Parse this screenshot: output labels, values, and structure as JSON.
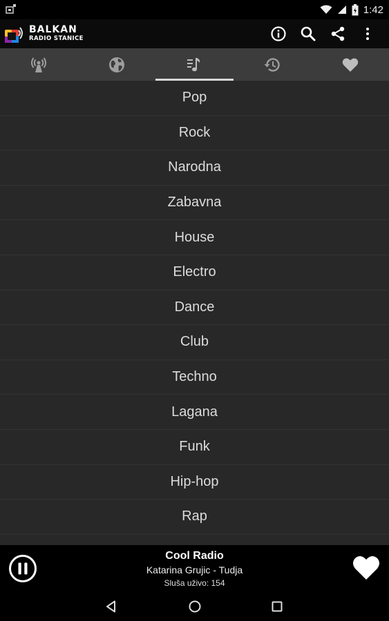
{
  "status_bar": {
    "time": "1:42",
    "icons": [
      "notification-icon",
      "wifi-icon",
      "cell-signal-icon",
      "battery-icon"
    ]
  },
  "app_bar": {
    "logo": {
      "line1": "BALKAN",
      "line2": "RADIO STANICE"
    },
    "actions": [
      "info-icon",
      "search-icon",
      "share-icon",
      "more-vert-icon"
    ]
  },
  "tabs": [
    {
      "icon": "radio-tower-icon",
      "active": false
    },
    {
      "icon": "globe-icon",
      "active": false
    },
    {
      "icon": "music-note-icon",
      "active": true
    },
    {
      "icon": "history-icon",
      "active": false
    },
    {
      "icon": "heart-icon",
      "active": false
    }
  ],
  "genres": [
    "Pop",
    "Rock",
    "Narodna",
    "Zabavna",
    "House",
    "Electro",
    "Dance",
    "Club",
    "Techno",
    "Lagana",
    "Funk",
    "Hip-hop",
    "Rap"
  ],
  "player": {
    "station": "Cool Radio",
    "track": "Katarina Grujic - Tudja",
    "listeners": "Sluša uživo: 154",
    "play_icon": "pause-icon",
    "fav_icon": "heart-icon"
  },
  "nav_bar": [
    "back-icon",
    "home-icon",
    "recents-icon"
  ],
  "colors": {
    "background": "#282828",
    "tab_bar": "#3c3c3c",
    "app_bar": "#0b0b0b",
    "text": "#dcdcdc"
  }
}
